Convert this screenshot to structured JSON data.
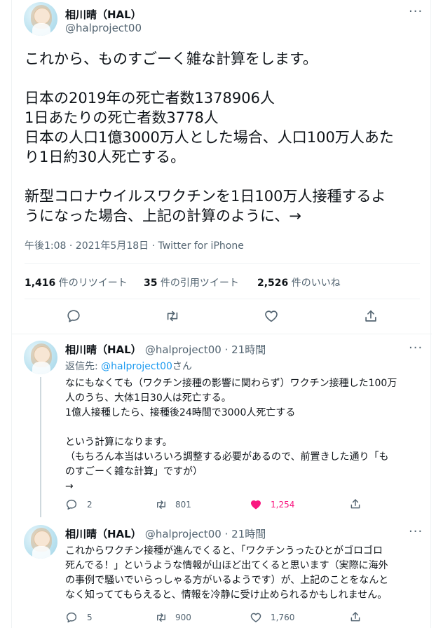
{
  "main_tweet": {
    "display_name": "相川晴（HAL）",
    "handle": "@halproject00",
    "lines": [
      "これから、ものすごーく雑な計算をします。",
      "",
      "日本の2019年の死亡者数1378906人",
      "1日あたりの死亡者数3778人",
      "日本の人口1億3000万人とした場合、人口100万人あた",
      "り1日約30人死亡する。",
      "",
      "新型コロナウイルスワクチンを1日100万人接種するよ",
      "うになった場合、上記の計算のように、→"
    ],
    "timestamp": "午後1:08 · 2021年5月18日 · Twitter for iPhone",
    "retweets_count": "1,416",
    "retweets_label": " 件のリツイート",
    "quotes_count": "35",
    "quotes_label": " 件の引用ツイート",
    "likes_count": "2,526",
    "likes_label": " 件のいいね"
  },
  "reply1": {
    "display_name": "相川晴（HAL）",
    "handle_time": "@halproject00 · 21時間",
    "replying_label": "返信先: ",
    "replying_handle": "@halproject00",
    "replying_suffix": "さん",
    "lines": [
      "なにもなくても（ワクチン接種の影響に関わらず）ワクチン接種した100万",
      "人のうち、大体1日30人は死亡する。",
      "1億人接種したら、接種後24時間で3000人死亡する",
      "",
      "という計算になります。",
      "（もちろん本当はいろいろ調整する必要があるので、前置きした通り「も",
      "のすごーく雑な計算」ですが）",
      "→"
    ],
    "reply_count": "2",
    "retweet_count": "801",
    "like_count": "1,254"
  },
  "reply2": {
    "display_name": "相川晴（HAL）",
    "handle_time": "@halproject00 · 21時間",
    "lines": [
      "これからワクチン接種が進んでくると、「ワクチンうったひとがゴロゴロ",
      "死んでる！」というような情報が山ほど出てくると思います（実際に海外",
      "の事例で騒いでいらっしゃる方がいるようです）が、上記のことをなんと",
      "なく知っててもらえると、情報を冷静に受け止められるかもしれません。"
    ],
    "reply_count": "5",
    "retweet_count": "900",
    "like_count": "1,760"
  },
  "colors": {
    "accent": "#1d9bf0",
    "like": "#f91880",
    "muted": "#536471",
    "text": "#0f1419"
  }
}
